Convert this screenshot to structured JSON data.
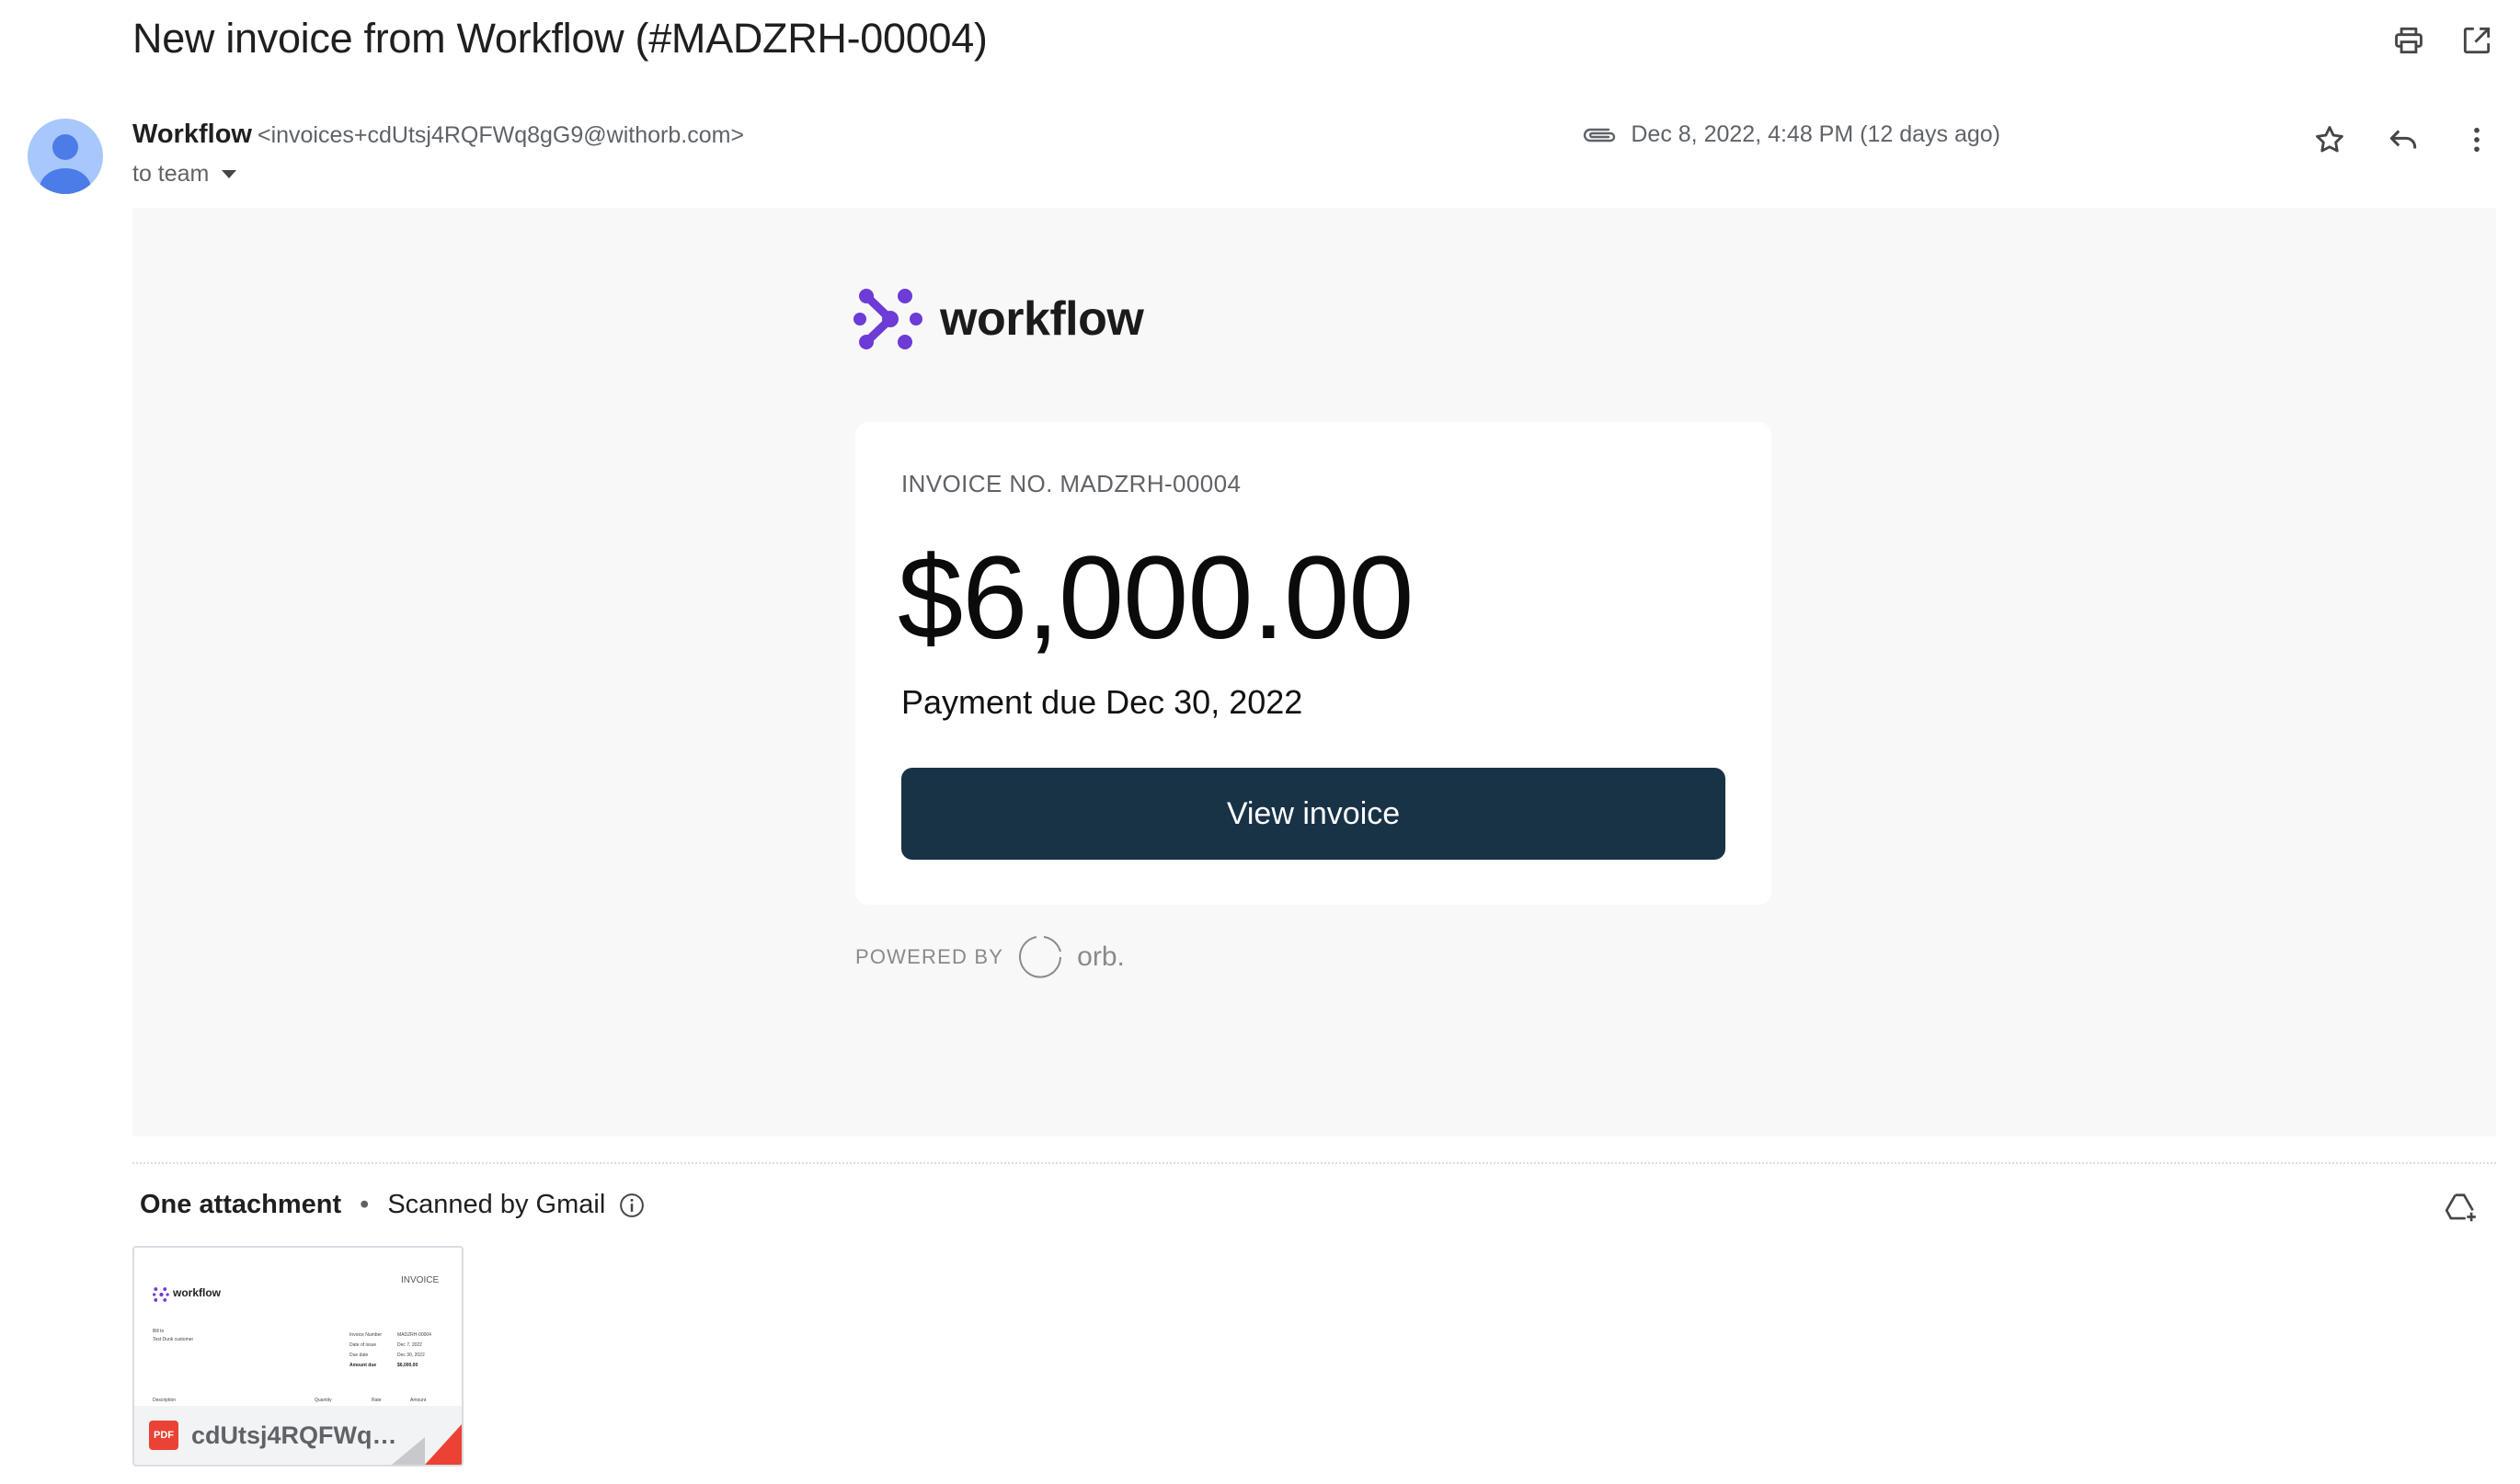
{
  "email": {
    "subject": "New invoice from Workflow (#MADZRH-00004)",
    "sender_name": "Workflow",
    "sender_email": "<invoices+cdUtsj4RQFWq8gG9@withorb.com>",
    "to_label": "to team",
    "date": "Dec 8, 2022, 4:48 PM (12 days ago)"
  },
  "icons": {
    "print": "print-icon",
    "open_new": "open-in-new-window-icon",
    "attachment": "paperclip-icon",
    "star": "star-icon",
    "reply": "reply-icon",
    "more": "more-vert-icon",
    "info": "info-icon",
    "drive": "add-to-drive-icon"
  },
  "invoice": {
    "brand": "workflow",
    "invoice_no": "INVOICE NO. MADZRH-00004",
    "amount": "$6,000.00",
    "due": "Payment due Dec 30, 2022",
    "button": "View invoice",
    "powered_by": "POWERED BY",
    "powered_brand": "orb."
  },
  "attachments": {
    "title": "One attachment",
    "separator": "•",
    "scanned": "Scanned by Gmail",
    "file_name": "cdUtsj4RQFWq8g...",
    "file_type": "PDF",
    "preview": {
      "brand": "workflow",
      "heading": "INVOICE",
      "bill_to_label": "Bill to",
      "bill_to_value": "Test Dunk customer",
      "row1_label": "Invoice Number",
      "row1_value": "MADZRH-00004",
      "row2_label": "Date of issue",
      "row2_value": "Dec 7, 2022",
      "row3_label": "Due date",
      "row3_value": "Dec 30, 2022",
      "row4_label": "Amount due",
      "row4_value": "$6,000.00",
      "col1": "Description",
      "col2": "Quantity",
      "col3": "Rate",
      "col4": "Amount"
    }
  },
  "colors": {
    "accent_purple": "#6d3bd6",
    "button_bg": "#183246",
    "body_bg": "#f8f8f8",
    "avatar_bg": "#a8c7fa",
    "avatar_fg": "#4b7ce8"
  }
}
